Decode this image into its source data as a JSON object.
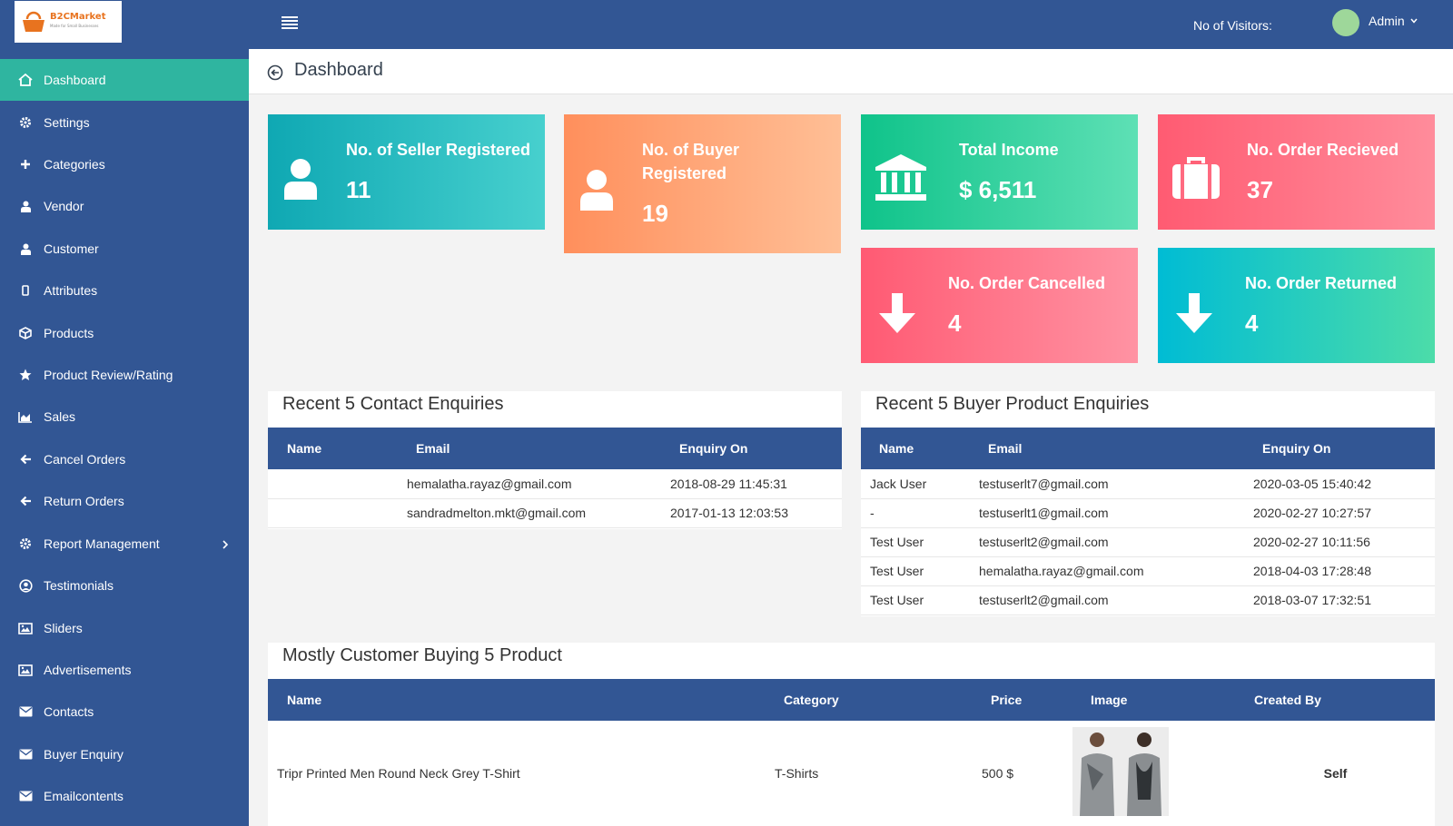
{
  "brand": {
    "logo_text": "B2CMarket",
    "tagline": "Made for Small Businesses"
  },
  "header": {
    "visitors_label": "No of Visitors:",
    "user_name": "Admin"
  },
  "sidebar": {
    "items": [
      {
        "label": "Dashboard",
        "icon": "home-icon"
      },
      {
        "label": "Settings",
        "icon": "gear-icon"
      },
      {
        "label": "Categories",
        "icon": "plus-icon"
      },
      {
        "label": "Vendor",
        "icon": "user-icon"
      },
      {
        "label": "Customer",
        "icon": "user-icon"
      },
      {
        "label": "Attributes",
        "icon": "mobile-icon"
      },
      {
        "label": "Products",
        "icon": "cube-icon"
      },
      {
        "label": "Product Review/Rating",
        "icon": "star-icon"
      },
      {
        "label": "Sales",
        "icon": "area-chart-icon"
      },
      {
        "label": "Cancel Orders",
        "icon": "arrow-left-icon"
      },
      {
        "label": "Return Orders",
        "icon": "arrow-left-icon"
      },
      {
        "label": "Report Management",
        "icon": "gear-icon"
      },
      {
        "label": "Testimonials",
        "icon": "user-circle-icon"
      },
      {
        "label": "Sliders",
        "icon": "image-icon"
      },
      {
        "label": "Advertisements",
        "icon": "image-icon"
      },
      {
        "label": "Contacts",
        "icon": "envelope-icon"
      },
      {
        "label": "Buyer Enquiry",
        "icon": "envelope-icon"
      },
      {
        "label": "Emailcontents",
        "icon": "envelope-icon"
      }
    ]
  },
  "page": {
    "title": "Dashboard"
  },
  "cards": {
    "sellers": {
      "label": "No. of Seller Registered",
      "value": "11",
      "icon": "user-icon"
    },
    "buyers": {
      "label": "No. of Buyer Registered",
      "value": "19",
      "icon": "user-icon"
    },
    "income": {
      "label": "Total Income",
      "value": "$ 6,511",
      "icon": "bank-icon"
    },
    "orders_received": {
      "label": "No. Order Recieved",
      "value": "37",
      "icon": "briefcase-icon"
    },
    "orders_cancelled": {
      "label": "No. Order Cancelled",
      "value": "4",
      "icon": "arrow-down-icon"
    },
    "orders_returned": {
      "label": "No. Order Returned",
      "value": "4",
      "icon": "arrow-down-icon"
    }
  },
  "contact_enquiries": {
    "title": "Recent 5 Contact Enquiries",
    "columns": [
      "Name",
      "Email",
      "Enquiry On"
    ],
    "rows": [
      {
        "name": "",
        "email": "hemalatha.rayaz@gmail.com",
        "date": "2018-08-29 11:45:31"
      },
      {
        "name": "",
        "email": "sandradmelton.mkt@gmail.com",
        "date": "2017-01-13 12:03:53"
      }
    ]
  },
  "buyer_enquiries": {
    "title": "Recent 5 Buyer Product Enquiries",
    "columns": [
      "Name",
      "Email",
      "Enquiry On"
    ],
    "rows": [
      {
        "name": "Jack User",
        "email": "testuserlt7@gmail.com",
        "date": "2020-03-05 15:40:42"
      },
      {
        "name": "-",
        "email": "testuserlt1@gmail.com",
        "date": "2020-02-27 10:27:57"
      },
      {
        "name": "Test User",
        "email": "testuserlt2@gmail.com",
        "date": "2020-02-27 10:11:56"
      },
      {
        "name": "Test User",
        "email": "hemalatha.rayaz@gmail.com",
        "date": "2018-04-03 17:28:48"
      },
      {
        "name": "Test User",
        "email": "testuserlt2@gmail.com",
        "date": "2018-03-07 17:32:51"
      }
    ]
  },
  "top_products": {
    "title": "Mostly Customer Buying 5 Product",
    "columns": [
      "Name",
      "Category",
      "Price",
      "Image",
      "Created By"
    ],
    "rows": [
      {
        "name": "Tripr Printed Men Round Neck Grey T-Shirt",
        "category": "T-Shirts",
        "price": "500 $",
        "created_by": "Self"
      }
    ]
  },
  "colors": {
    "header": "#325694",
    "active": "#2fb5a0",
    "teal": "#13a9b5",
    "orange": "#ff9a66",
    "green": "#13c78b",
    "red": "#ff5a73",
    "cyan": "#00bcd4"
  }
}
